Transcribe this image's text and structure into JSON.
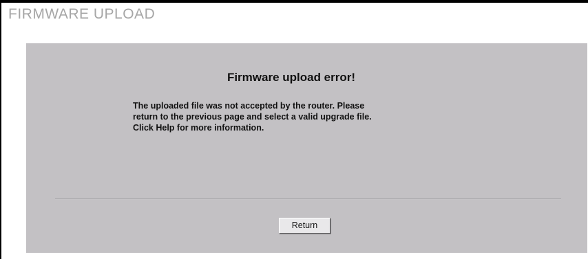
{
  "page": {
    "title": "FIRMWARE UPLOAD"
  },
  "error": {
    "heading": "Firmware upload error!",
    "message_lines": [
      "The uploaded file was not accepted by the router. Please",
      "return to the previous page and select a valid upgrade file.",
      "Click Help for more information."
    ]
  },
  "actions": {
    "return_label": "Return"
  },
  "colors": {
    "title": "#a6a6a6",
    "panel_background": "#c3c1c4",
    "button_face": "#e9e8ea"
  }
}
